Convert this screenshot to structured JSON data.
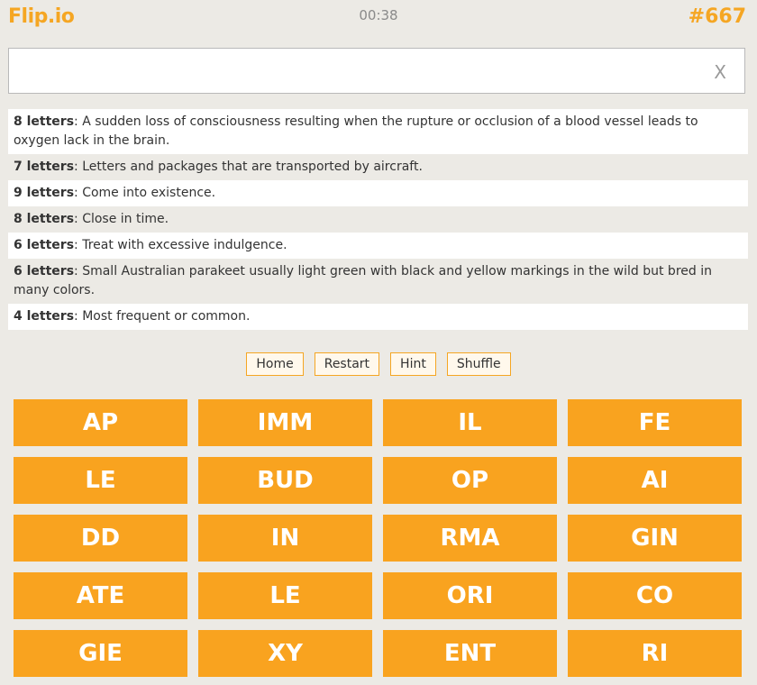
{
  "header": {
    "logo": "Flip.io",
    "timer": "00:38",
    "puzzle_number": "#667"
  },
  "answer": {
    "value": "",
    "clear_label": "X"
  },
  "clues": [
    {
      "length": "8 letters",
      "text": ": A sudden loss of consciousness resulting when the rupture or occlusion of a blood vessel leads to oxygen lack in the brain."
    },
    {
      "length": "7 letters",
      "text": ": Letters and packages that are transported by aircraft."
    },
    {
      "length": "9 letters",
      "text": ": Come into existence."
    },
    {
      "length": "8 letters",
      "text": ": Close in time."
    },
    {
      "length": "6 letters",
      "text": ": Treat with excessive indulgence."
    },
    {
      "length": "6 letters",
      "text": ": Small Australian parakeet usually light green with black and yellow markings in the wild but bred in many colors."
    },
    {
      "length": "4 letters",
      "text": ": Most frequent or common."
    }
  ],
  "controls": {
    "home": "Home",
    "restart": "Restart",
    "hint": "Hint",
    "shuffle": "Shuffle"
  },
  "tiles": [
    "AP",
    "IMM",
    "IL",
    "FE",
    "LE",
    "BUD",
    "OP",
    "AI",
    "DD",
    "IN",
    "RMA",
    "GIN",
    "ATE",
    "LE",
    "ORI",
    "CO",
    "GIE",
    "XY",
    "ENT",
    "RI"
  ],
  "colors": {
    "accent": "#F5A623",
    "tile": "#F9A31F",
    "background": "#ECEAE5"
  }
}
